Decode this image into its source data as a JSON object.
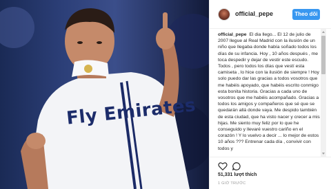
{
  "post": {
    "username": "official_pepe",
    "follow_label": "Theo dõi",
    "caption_user": "official_pepe",
    "caption_text": "El dia llego... El 12 de julio de 2007 llegue al Real Madrid con la ilusión de un niño que llegaba donde había soñado todos los días de su infancia. Hoy , 10 años después , me toca despedir y dejar de vestir este escudo. Todos , pero todos los días que vestí esta camiseta , lo hice con la ilusión de siempre ! Hoy solo puedo dar las gracias a todos vosotros que me habéis apoyado, que habéis escrito conmigo esta bonita historia. Gracias a cada uno de vosotros que me habéis acompañado. Gracias a todos los amigos y compañeros que sé que se quedarán allá donde vaya. Me despido también de esta ciudad, que ha visto nacer y crecer a mis hijas. Me siento muy feliz por lo que he conseguido y llevaré vuestro cariño en el corazón ! Y lo vuelvo a decir ... lo mejor de estos 10 años ??? Entrenar cada día , convivir con todos y",
    "likes": "51,331 lượt thích",
    "time": "1 GIỜ TRƯỚC"
  },
  "photo": {
    "jersey_text": "Fly Emirates"
  },
  "icons": {
    "like": "heart-icon",
    "comment": "comment-icon"
  },
  "colors": {
    "accent": "#3897f0",
    "background_photo": "#2c3f78"
  }
}
